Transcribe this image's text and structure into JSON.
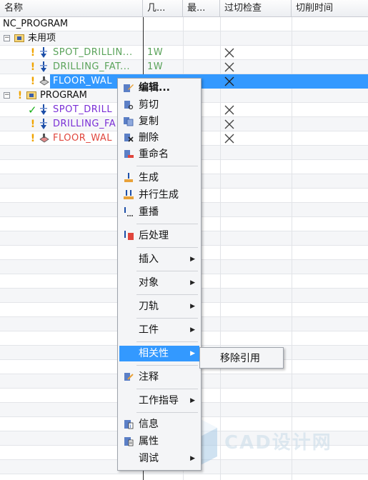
{
  "header": {
    "columns": [
      "名称",
      "几...",
      "最...",
      "过切检查",
      "切削时间"
    ]
  },
  "tree": {
    "root": "NC_PROGRAM",
    "unused_group": "未用项",
    "unused_items": [
      {
        "name": "SPOT_DRILLIN...",
        "col2": "1W"
      },
      {
        "name": "DRILLING_FAT...",
        "col2": "1W"
      },
      {
        "name": "FLOOR_WAL",
        "col2": ""
      }
    ],
    "program_group": "PROGRAM",
    "program_items": [
      {
        "name": "SPOT_DRILL"
      },
      {
        "name": "DRILLING_FA"
      },
      {
        "name": "FLOOR_WAL"
      }
    ]
  },
  "context_menu": {
    "edit": "编辑...",
    "cut": "剪切",
    "copy": "复制",
    "delete": "删除",
    "rename": "重命名",
    "generate": "生成",
    "parallel_generate": "并行生成",
    "replay": "重播",
    "postprocess": "后处理",
    "insert": "插入",
    "object": "对象",
    "toolpath": "刀轨",
    "workpiece": "工件",
    "dependency": "相关性",
    "annotation": "注释",
    "work_instruction": "工作指导",
    "info": "信息",
    "properties": "属性",
    "debug": "调试"
  },
  "submenu": {
    "remove_reference": "移除引用"
  },
  "watermark": "CAD设计网",
  "colors": {
    "selection": "#3399ff",
    "green_text": "#5aa35a",
    "purple_text": "#7a2fd6",
    "red_text": "#e0463d",
    "check": "#19b019",
    "warning": "#f0a400"
  }
}
